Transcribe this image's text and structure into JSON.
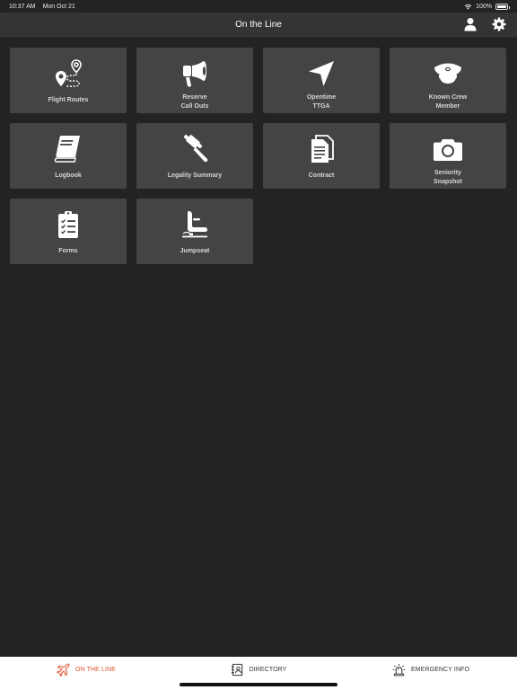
{
  "status": {
    "time": "10:37 AM",
    "date": "Mon Oct 21",
    "battery_text": "100%",
    "battery_level": 1.0
  },
  "nav": {
    "title": "On the Line",
    "profile_icon": "person-icon",
    "settings_icon": "gear-icon"
  },
  "tiles": [
    {
      "label": "Flight Routes",
      "icon": "map-route-icon"
    },
    {
      "label": "Reserve\nCall Outs",
      "icon": "megaphone-icon"
    },
    {
      "label": "Opentime\nTTGA",
      "icon": "location-arrow-icon"
    },
    {
      "label": "Known Crew\nMember",
      "icon": "pilot-cap-icon"
    },
    {
      "label": "Logbook",
      "icon": "book-icon"
    },
    {
      "label": "Legality Summary",
      "icon": "gavel-icon"
    },
    {
      "label": "Contract",
      "icon": "document-icon"
    },
    {
      "label": "Seniority\nSnapshot",
      "icon": "camera-icon"
    },
    {
      "label": "Forms",
      "icon": "clipboard-checklist-icon"
    },
    {
      "label": "Jumpseat",
      "icon": "seat-icon"
    }
  ],
  "tabs": [
    {
      "label": "ON THE LINE",
      "icon": "airplane-icon",
      "active": true
    },
    {
      "label": "DIRECTORY",
      "icon": "contacts-book-icon",
      "active": false
    },
    {
      "label": "EMERGENCY INFO",
      "icon": "siren-icon",
      "active": false
    }
  ],
  "colors": {
    "background": "#232323",
    "nav_background": "#343434",
    "tile_background": "#444444",
    "accent": "#d9532a"
  }
}
